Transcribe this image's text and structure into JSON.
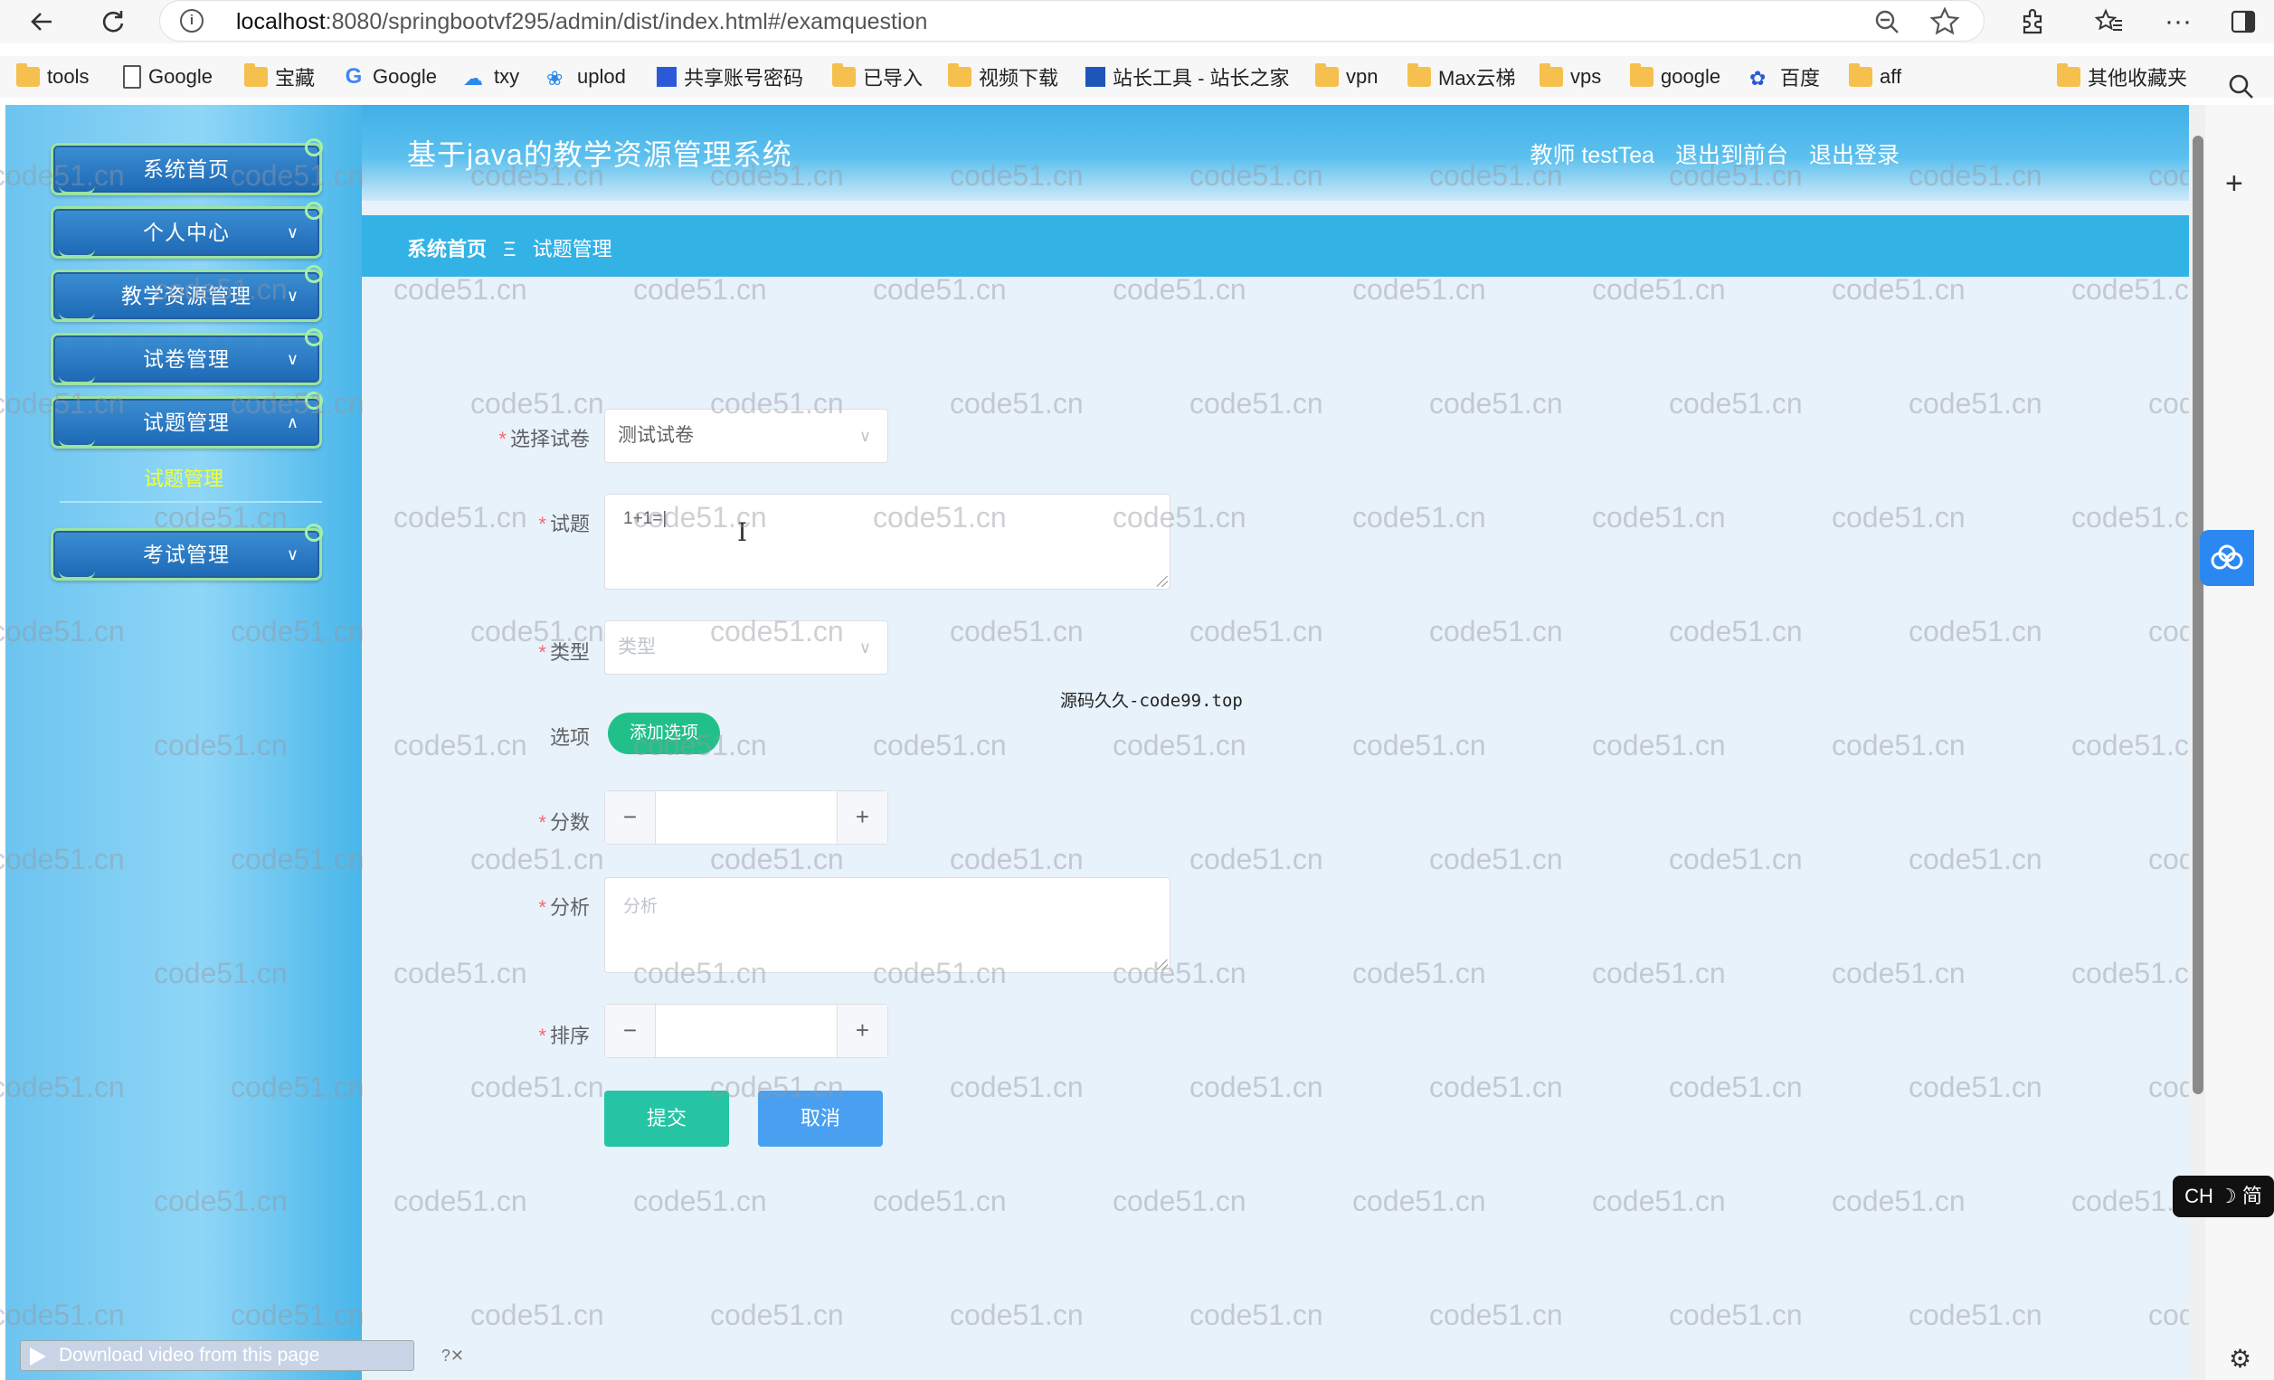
{
  "browser": {
    "url_host": "localhost",
    "url_path": ":8080/springbootvf295/admin/dist/index.html#/examquestion",
    "bookmarks": [
      "tools",
      "Google",
      "宝藏",
      "Google",
      "txy",
      "uplod",
      "共享账号密码",
      "已导入",
      "视频下载",
      "站长工具 - 站长之家",
      "vpn",
      "Max云梯",
      "vps",
      "google",
      "百度",
      "aff"
    ],
    "other_bookmarks": "其他收藏夹",
    "icons": [
      "back-icon",
      "reload-icon",
      "info-icon",
      "zoom-out-icon",
      "star-icon",
      "extensions-icon",
      "favorites-icon",
      "more-icon",
      "sidebar-icon"
    ]
  },
  "header": {
    "title": "基于java的教学资源管理系统",
    "user": "教师 testTea",
    "to_front": "退出到前台",
    "logout": "退出登录"
  },
  "sidebar": {
    "items": [
      "系统首页",
      "个人中心",
      "教学资源管理",
      "试卷管理",
      "试题管理",
      "考试管理"
    ],
    "active_sub": "试题管理"
  },
  "breadcrumb": {
    "home": "系统首页",
    "sep": "Ξ",
    "current": "试题管理"
  },
  "form": {
    "paper_label": "选择试卷",
    "paper_value": "测试试卷",
    "question_label": "试题",
    "question_value": "1+1=|",
    "type_label": "类型",
    "type_placeholder": "类型",
    "options_label": "选项",
    "add_option": "添加选项",
    "score_label": "分数",
    "analysis_label": "分析",
    "analysis_placeholder": "分析",
    "sort_label": "排序",
    "submit": "提交",
    "cancel": "取消",
    "overlay": "源码久久-code99.top"
  },
  "watermark": "code51.cn",
  "extras": {
    "download_bar": "Download video from this page",
    "ime": "CH ☽ 简"
  },
  "colors": {
    "header": "#3fb0e8",
    "crumbbar": "#33b2e6",
    "submit": "#25c4a4",
    "cancel": "#4aa0f0",
    "add_option": "#21c08b"
  }
}
